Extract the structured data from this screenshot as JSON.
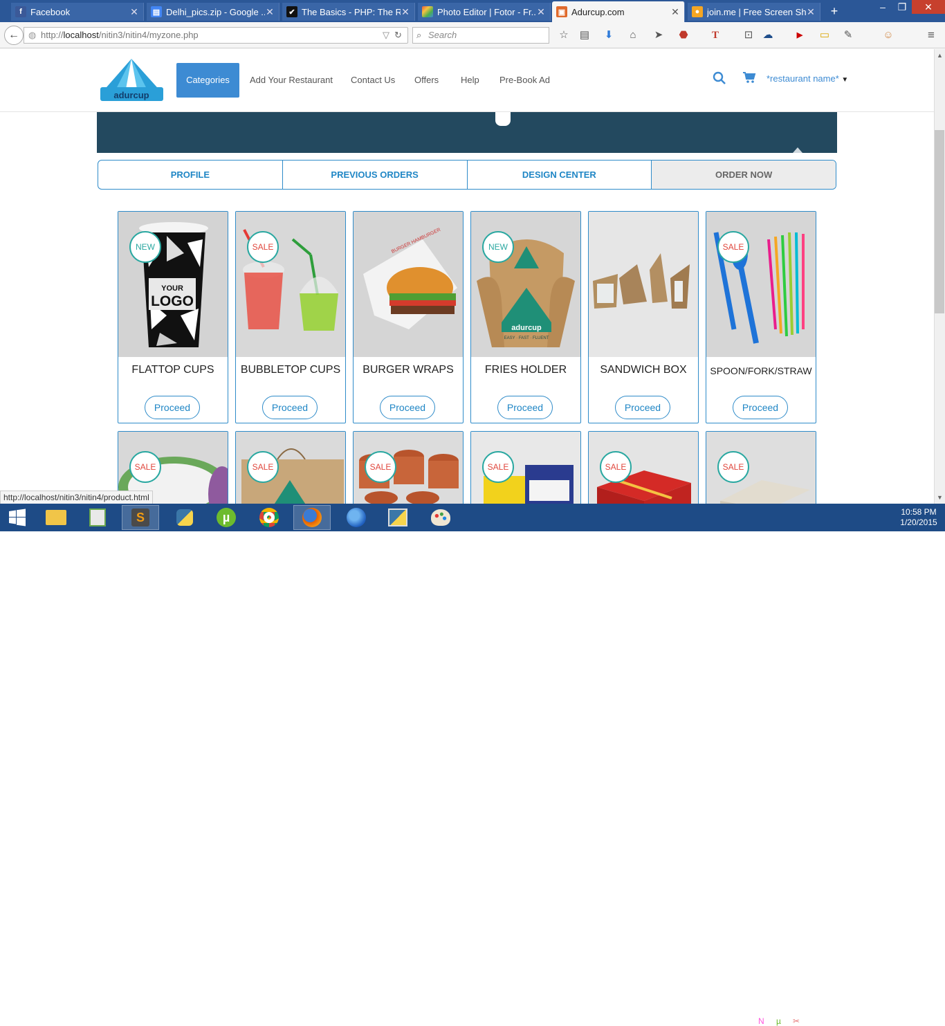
{
  "browser": {
    "tabs": [
      {
        "label": "Facebook",
        "icon": "f",
        "color": "#3b5998"
      },
      {
        "label": "Delhi_pics.zip - Google ...",
        "icon": "▤",
        "color": "#4285f4"
      },
      {
        "label": "The Basics - PHP: The Ri...",
        "icon": "✔",
        "color": "#111111"
      },
      {
        "label": "Photo Editor | Fotor - Fr...",
        "icon": "◆",
        "color": "#e85d3d"
      },
      {
        "label": "Adurcup.com",
        "icon": "▣",
        "color": "#e06a2c"
      },
      {
        "label": "join.me | Free Screen Sh...",
        "icon": "●",
        "color": "#f5a623"
      }
    ],
    "url_prefix": "http://",
    "url_host": "localhost",
    "url_path": "/nitin3/nitin4/myzone.php",
    "search_placeholder": "Search",
    "status_url": "http://localhost/nitin3/nitin4/product.html"
  },
  "site": {
    "logo_text": "adurcup",
    "menu": [
      "Categories",
      "Add Your Restaurant",
      "Contact Us",
      "Offers",
      "Help",
      "Pre-Book Ad"
    ],
    "restaurant_name": "*restaurant name*",
    "subtabs": [
      "PROFILE",
      "PREVIOUS ORDERS",
      "DESIGN CENTER",
      "ORDER NOW"
    ],
    "products": [
      {
        "title": "FLATTOP CUPS",
        "badge": "NEW",
        "button": "Proceed"
      },
      {
        "title": "BUBBLETOP CUPS",
        "badge": "SALE",
        "button": "Proceed"
      },
      {
        "title": "BURGER WRAPS",
        "badge": "",
        "button": "Proceed"
      },
      {
        "title": "FRIES HOLDER",
        "badge": "NEW",
        "button": "Proceed"
      },
      {
        "title": "SANDWICH BOX",
        "badge": "",
        "button": "Proceed"
      },
      {
        "title": "SPOON/FORK/STRAW",
        "badge": "SALE",
        "button": "Proceed"
      }
    ],
    "products_row2_badges": [
      "SALE",
      "SALE",
      "SALE",
      "SALE",
      "SALE",
      "SALE"
    ],
    "cup_print": "YOUR LOGO",
    "fries_logo": "adurcup",
    "fries_tagline": "EASY · FAST · FLUENT",
    "wrap_print": "BURGER HAMBURGER"
  },
  "taskbar": {
    "time": "10:58 PM",
    "date": "1/20/2015"
  },
  "colors": {
    "accent": "#3d8bd3",
    "border": "#2e8bc9",
    "banner": "#23495f"
  }
}
